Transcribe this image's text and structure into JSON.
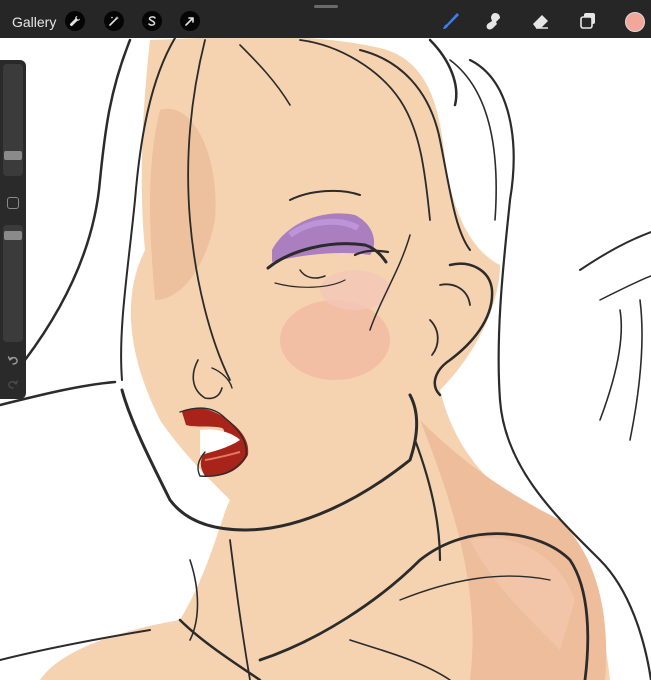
{
  "topbar": {
    "gallery_label": "Gallery",
    "left_tools": [
      {
        "name": "actions",
        "icon": "wrench-icon"
      },
      {
        "name": "adjustments",
        "icon": "magic-wand-icon"
      },
      {
        "name": "selection",
        "icon": "selection-s-icon"
      },
      {
        "name": "transform",
        "icon": "arrow-cursor-icon"
      }
    ],
    "right_tools": [
      {
        "name": "brush",
        "icon": "brush-icon",
        "active": true
      },
      {
        "name": "smudge",
        "icon": "smudge-icon"
      },
      {
        "name": "eraser",
        "icon": "eraser-icon"
      },
      {
        "name": "layers",
        "icon": "layers-icon"
      }
    ],
    "current_color": "#f2a79b",
    "active_tool_color": "#3b7ff5"
  },
  "sidebar": {
    "brush_size_level": 0.15,
    "opacity_level": 0.85,
    "icons": [
      "square-modify-icon",
      "undo-icon",
      "redo-icon"
    ]
  },
  "canvas": {
    "skin_color": "#f6d3b0",
    "shadow_color": "#eeb898",
    "lip_color": "#a8231a",
    "eyeshadow_color": "#9c6fc2",
    "line_color": "#2b2b2b"
  }
}
